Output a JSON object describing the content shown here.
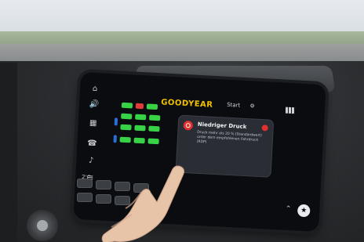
{
  "screen": {
    "brand": "GOODYEAR",
    "alert": {
      "title": "Niedriger Druck",
      "text": "Druck mehr als 20 % (Standardwert) unter dem empfohlenen Fahrdruck (RDP)"
    },
    "top_bar": [
      "Start",
      "⚙"
    ],
    "bottom_left": "2'C",
    "bottom_right_icon": "star-icon"
  },
  "colors": {
    "brand": "#f2c200",
    "alert_red": "#e02f2f",
    "tire_ok": "#37d246",
    "tire_low": "#e33a3a"
  }
}
